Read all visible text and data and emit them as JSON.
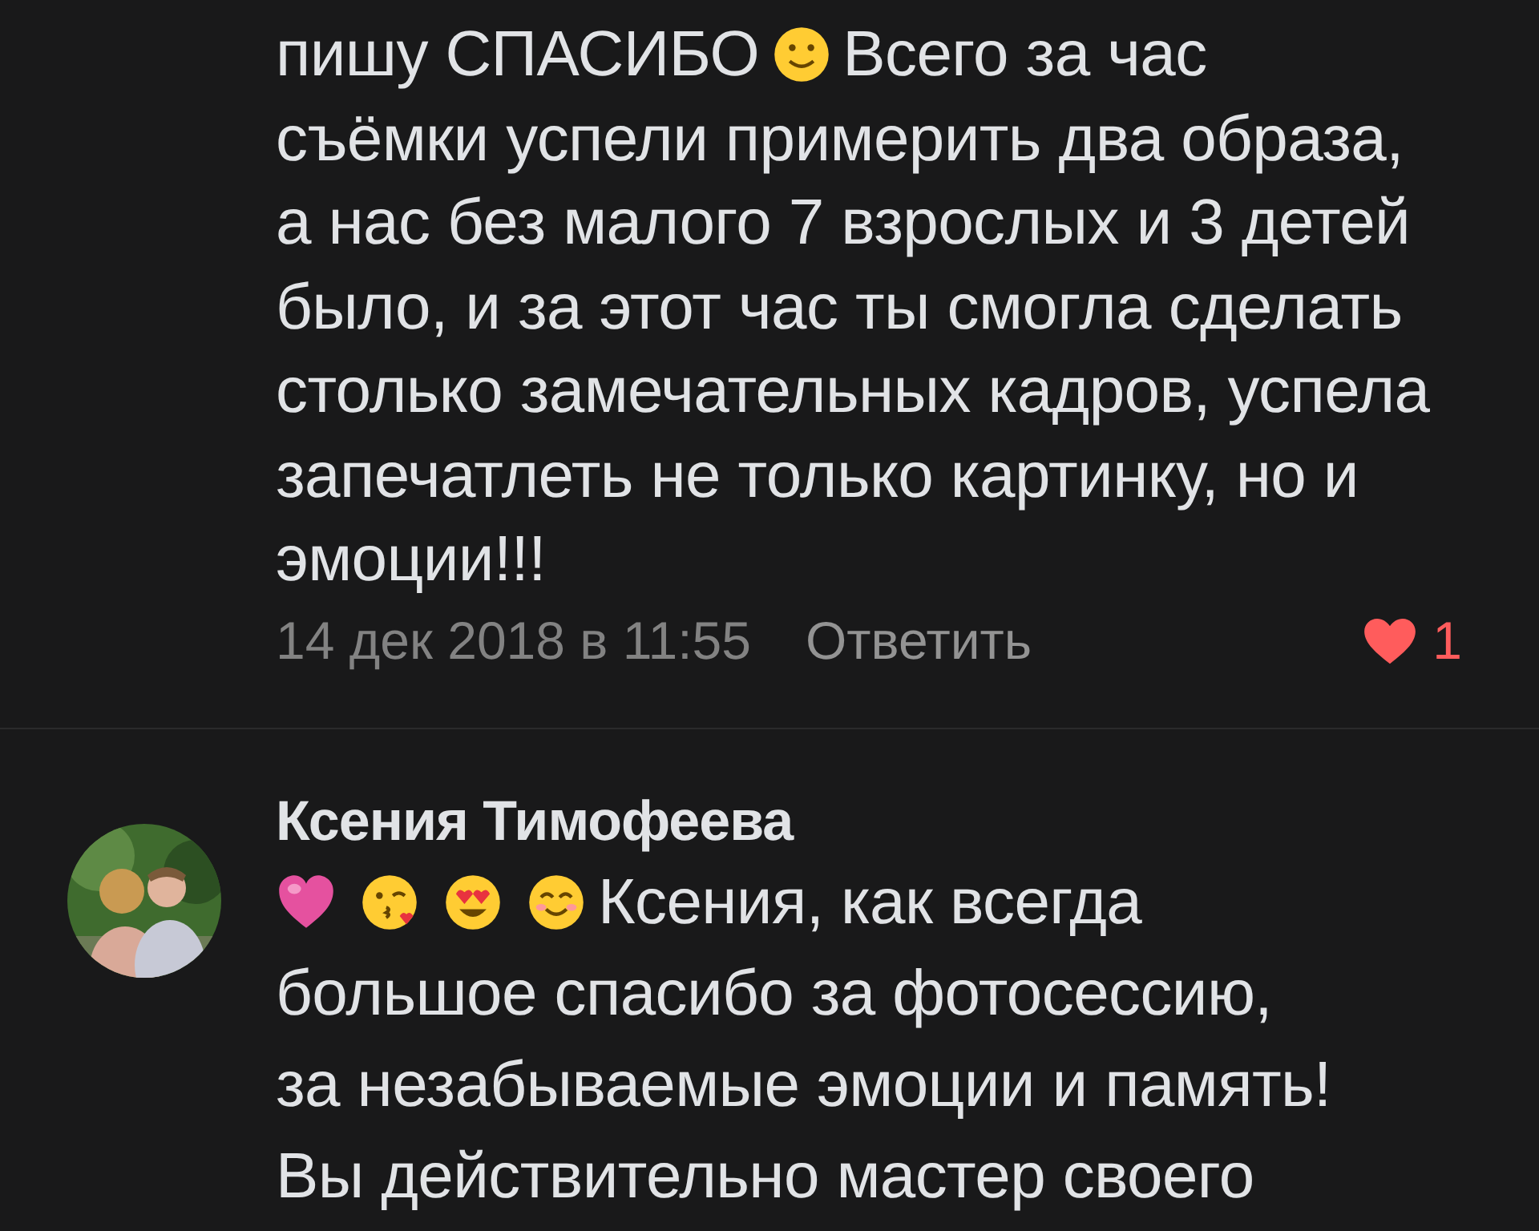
{
  "comments": [
    {
      "lines": [
        [
          {
            "kind": "text",
            "text": "пишу СПАСИБО"
          },
          {
            "kind": "smile"
          },
          {
            "kind": "text",
            "text": "Всего за час"
          }
        ],
        [
          {
            "kind": "text",
            "text": "съёмки успели примерить два образа,"
          }
        ],
        [
          {
            "kind": "text",
            "text": "а нас без малого 7 взрослых и 3 детей"
          }
        ],
        [
          {
            "kind": "text",
            "text": "было, и за этот час ты смогла сделать"
          }
        ],
        [
          {
            "kind": "text",
            "text": "столько замечательных кадров, успела"
          }
        ],
        [
          {
            "kind": "text",
            "text": "запечатлеть не только картинку, но и"
          }
        ],
        [
          {
            "kind": "text",
            "text": "эмоции!!!"
          }
        ]
      ],
      "date": "14 дек 2018 в 11:55",
      "reply": "Ответить",
      "likes": "1",
      "liked": true
    },
    {
      "author": "Ксения Тимофеева",
      "avatar": {
        "kind": "picture"
      },
      "lines": [
        [
          {
            "kind": "heart"
          },
          {
            "kind": "kiss"
          },
          {
            "kind": "heart-eyes"
          },
          {
            "kind": "blush"
          },
          {
            "kind": "text",
            "text": "Ксения, как всегда"
          }
        ],
        [
          {
            "kind": "text",
            "text": "большое спасибо за фотосессию,"
          }
        ],
        [
          {
            "kind": "text",
            "text": "за незабываемые эмоции и память!"
          }
        ],
        [
          {
            "kind": "text",
            "text": "Вы действительно мастер своего"
          }
        ]
      ]
    }
  ]
}
